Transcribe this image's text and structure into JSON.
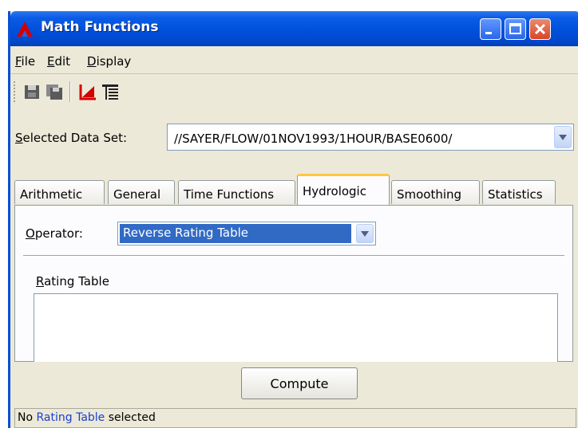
{
  "window": {
    "title": "Math Functions"
  },
  "menu": [
    "File",
    "Edit",
    "Display"
  ],
  "toolbar": {
    "icons": [
      "save-icon",
      "save-as-icon",
      "plot-icon",
      "tabulate-icon"
    ]
  },
  "dataset": {
    "label": "Selected Data Set:",
    "value": "//SAYER/FLOW/01NOV1993/1HOUR/BASE0600/"
  },
  "tabs": [
    "Arithmetic",
    "General",
    "Time Functions",
    "Hydrologic",
    "Smoothing",
    "Statistics"
  ],
  "active_tab": "Hydrologic",
  "operator": {
    "label": "Operator:",
    "value": "Reverse Rating Table"
  },
  "rating_table": {
    "label": "Rating Table"
  },
  "compute_label": "Compute",
  "status": {
    "prefix": "No ",
    "link": "Rating Table",
    "suffix": " selected"
  },
  "colors": {
    "title_bar": "#0050dc",
    "selection": "#316ac5",
    "active_tab_accent": "#ffc83c",
    "status_link": "#1a3fd0"
  }
}
